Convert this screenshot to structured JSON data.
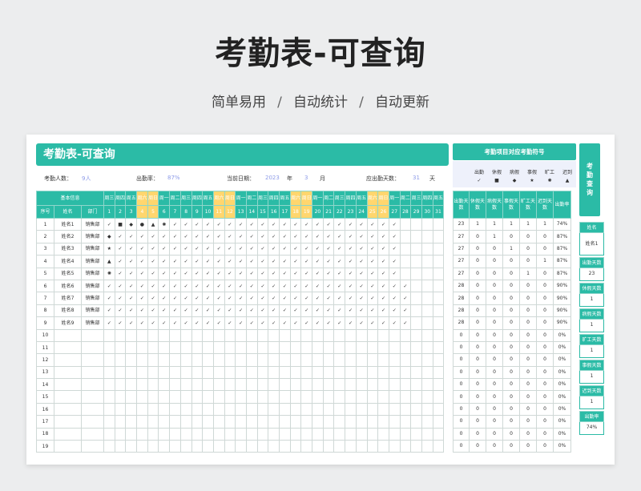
{
  "hero": {
    "title": "考勤表-可查询",
    "taglines": [
      "简单易用",
      "自动统计",
      "自动更新"
    ],
    "separator": "/"
  },
  "sheet": {
    "banner_title": "考勤表-可查询",
    "info": {
      "headcount_label": "考勤人数：",
      "headcount_value": "9人",
      "rate_label": "出勤率：",
      "rate_value": "87%",
      "date_label": "当前日期：",
      "year_value": "2023",
      "year_unit": "年",
      "month_value": "3",
      "month_unit": "月",
      "workdays_label": "应出勤天数：",
      "workdays_value": "31",
      "workdays_unit": "天"
    },
    "header": {
      "basic_info": "基本信息",
      "col_seq": "序号",
      "col_name": "姓名",
      "col_dept": "部门",
      "weekdays": [
        "周三",
        "周四",
        "周五",
        "周六",
        "周日",
        "周一",
        "周二",
        "周三",
        "周四",
        "周五",
        "周六",
        "周日",
        "周一",
        "周二",
        "周三",
        "周四",
        "周五",
        "周六",
        "周日",
        "周一",
        "周二",
        "周三",
        "周四",
        "周五",
        "周六",
        "周日",
        "周一",
        "周二",
        "周三",
        "周四",
        "周五"
      ],
      "days": [
        "1",
        "2",
        "3",
        "4",
        "5",
        "6",
        "7",
        "8",
        "9",
        "10",
        "11",
        "12",
        "13",
        "14",
        "15",
        "16",
        "17",
        "18",
        "19",
        "20",
        "21",
        "22",
        "23",
        "24",
        "25",
        "26",
        "27",
        "28",
        "29",
        "30",
        "31"
      ]
    },
    "rows": [
      {
        "seq": "1",
        "name": "姓名1",
        "dept": "销售部",
        "marks": [
          "✓",
          "■",
          "◆",
          "●",
          "▲",
          "✺",
          "✓",
          "✓",
          "✓",
          "✓",
          "✓",
          "✓",
          "✓",
          "✓",
          "✓",
          "✓",
          "✓",
          "✓",
          "✓",
          "✓",
          "✓",
          "✓",
          "✓",
          "✓",
          "✓",
          "✓",
          "✓",
          "",
          "",
          "",
          ""
        ]
      },
      {
        "seq": "2",
        "name": "姓名2",
        "dept": "销售部",
        "marks": [
          "◆",
          "✓",
          "✓",
          "✓",
          "✓",
          "✓",
          "✓",
          "✓",
          "✓",
          "✓",
          "✓",
          "✓",
          "✓",
          "✓",
          "✓",
          "✓",
          "✓",
          "✓",
          "✓",
          "✓",
          "✓",
          "✓",
          "✓",
          "✓",
          "✓",
          "✓",
          "✓",
          "",
          "",
          "",
          ""
        ]
      },
      {
        "seq": "3",
        "name": "姓名3",
        "dept": "销售部",
        "marks": [
          "★",
          "✓",
          "✓",
          "✓",
          "✓",
          "✓",
          "✓",
          "✓",
          "✓",
          "✓",
          "✓",
          "✓",
          "✓",
          "✓",
          "✓",
          "✓",
          "✓",
          "✓",
          "✓",
          "✓",
          "✓",
          "✓",
          "✓",
          "✓",
          "✓",
          "✓",
          "✓",
          "",
          "",
          "",
          ""
        ]
      },
      {
        "seq": "4",
        "name": "姓名4",
        "dept": "销售部",
        "marks": [
          "▲",
          "✓",
          "✓",
          "✓",
          "✓",
          "✓",
          "✓",
          "✓",
          "✓",
          "✓",
          "✓",
          "✓",
          "✓",
          "✓",
          "✓",
          "✓",
          "✓",
          "✓",
          "✓",
          "✓",
          "✓",
          "✓",
          "✓",
          "✓",
          "✓",
          "✓",
          "✓",
          "",
          "",
          "",
          ""
        ]
      },
      {
        "seq": "5",
        "name": "姓名5",
        "dept": "销售部",
        "marks": [
          "✺",
          "✓",
          "✓",
          "✓",
          "✓",
          "✓",
          "✓",
          "✓",
          "✓",
          "✓",
          "✓",
          "✓",
          "✓",
          "✓",
          "✓",
          "✓",
          "✓",
          "✓",
          "✓",
          "✓",
          "✓",
          "✓",
          "✓",
          "✓",
          "✓",
          "✓",
          "✓",
          "",
          "",
          "",
          ""
        ]
      },
      {
        "seq": "6",
        "name": "姓名6",
        "dept": "销售部",
        "marks": [
          "✓",
          "✓",
          "✓",
          "✓",
          "✓",
          "✓",
          "✓",
          "✓",
          "✓",
          "✓",
          "✓",
          "✓",
          "✓",
          "✓",
          "✓",
          "✓",
          "✓",
          "✓",
          "✓",
          "✓",
          "✓",
          "✓",
          "✓",
          "✓",
          "✓",
          "✓",
          "✓",
          "✓",
          "",
          "",
          ""
        ]
      },
      {
        "seq": "7",
        "name": "姓名7",
        "dept": "销售部",
        "marks": [
          "✓",
          "✓",
          "✓",
          "✓",
          "✓",
          "✓",
          "✓",
          "✓",
          "✓",
          "✓",
          "✓",
          "✓",
          "✓",
          "✓",
          "✓",
          "✓",
          "✓",
          "✓",
          "✓",
          "✓",
          "✓",
          "✓",
          "✓",
          "✓",
          "✓",
          "✓",
          "✓",
          "✓",
          "",
          "",
          ""
        ]
      },
      {
        "seq": "8",
        "name": "姓名8",
        "dept": "销售部",
        "marks": [
          "✓",
          "✓",
          "✓",
          "✓",
          "✓",
          "✓",
          "✓",
          "✓",
          "✓",
          "✓",
          "✓",
          "✓",
          "✓",
          "✓",
          "✓",
          "✓",
          "✓",
          "✓",
          "✓",
          "✓",
          "✓",
          "✓",
          "✓",
          "✓",
          "✓",
          "✓",
          "✓",
          "✓",
          "",
          "",
          ""
        ]
      },
      {
        "seq": "9",
        "name": "姓名9",
        "dept": "销售部",
        "marks": [
          "✓",
          "✓",
          "✓",
          "✓",
          "✓",
          "✓",
          "✓",
          "✓",
          "✓",
          "✓",
          "✓",
          "✓",
          "✓",
          "✓",
          "✓",
          "✓",
          "✓",
          "✓",
          "✓",
          "✓",
          "✓",
          "✓",
          "✓",
          "✓",
          "✓",
          "✓",
          "✓",
          "✓",
          "",
          "",
          ""
        ]
      },
      {
        "seq": "10",
        "name": "",
        "dept": "",
        "marks": []
      },
      {
        "seq": "11",
        "name": "",
        "dept": "",
        "marks": []
      },
      {
        "seq": "12",
        "name": "",
        "dept": "",
        "marks": []
      },
      {
        "seq": "13",
        "name": "",
        "dept": "",
        "marks": []
      },
      {
        "seq": "14",
        "name": "",
        "dept": "",
        "marks": []
      },
      {
        "seq": "15",
        "name": "",
        "dept": "",
        "marks": []
      },
      {
        "seq": "16",
        "name": "",
        "dept": "",
        "marks": []
      },
      {
        "seq": "17",
        "name": "",
        "dept": "",
        "marks": []
      },
      {
        "seq": "18",
        "name": "",
        "dept": "",
        "marks": []
      },
      {
        "seq": "19",
        "name": "",
        "dept": "",
        "marks": []
      }
    ]
  },
  "legend": {
    "title": "考勤项目对应考勤符号",
    "items": [
      "出勤",
      "休假",
      "病假",
      "事假",
      "旷工",
      "迟到"
    ],
    "symbols": [
      "✓",
      "■",
      "◆",
      "★",
      "✺",
      "▲"
    ]
  },
  "stats": {
    "headers": [
      "出勤天数",
      "休假天数",
      "病假天数",
      "事假天数",
      "旷工天数",
      "迟到天数",
      "出勤率"
    ],
    "rows": [
      [
        "23",
        "1",
        "1",
        "1",
        "1",
        "1",
        "74%"
      ],
      [
        "27",
        "0",
        "1",
        "0",
        "0",
        "0",
        "87%"
      ],
      [
        "27",
        "0",
        "0",
        "1",
        "0",
        "0",
        "87%"
      ],
      [
        "27",
        "0",
        "0",
        "0",
        "0",
        "1",
        "87%"
      ],
      [
        "27",
        "0",
        "0",
        "0",
        "1",
        "0",
        "87%"
      ],
      [
        "28",
        "0",
        "0",
        "0",
        "0",
        "0",
        "90%"
      ],
      [
        "28",
        "0",
        "0",
        "0",
        "0",
        "0",
        "90%"
      ],
      [
        "28",
        "0",
        "0",
        "0",
        "0",
        "0",
        "90%"
      ],
      [
        "28",
        "0",
        "0",
        "0",
        "0",
        "0",
        "90%"
      ],
      [
        "0",
        "0",
        "0",
        "0",
        "0",
        "0",
        "0%"
      ],
      [
        "0",
        "0",
        "0",
        "0",
        "0",
        "0",
        "0%"
      ],
      [
        "0",
        "0",
        "0",
        "0",
        "0",
        "0",
        "0%"
      ],
      [
        "0",
        "0",
        "0",
        "0",
        "0",
        "0",
        "0%"
      ],
      [
        "0",
        "0",
        "0",
        "0",
        "0",
        "0",
        "0%"
      ],
      [
        "0",
        "0",
        "0",
        "0",
        "0",
        "0",
        "0%"
      ],
      [
        "0",
        "0",
        "0",
        "0",
        "0",
        "0",
        "0%"
      ],
      [
        "0",
        "0",
        "0",
        "0",
        "0",
        "0",
        "0%"
      ],
      [
        "0",
        "0",
        "0",
        "0",
        "0",
        "0",
        "0%"
      ],
      [
        "0",
        "0",
        "0",
        "0",
        "0",
        "0",
        "0%"
      ]
    ]
  },
  "query": {
    "button": "考勤查询",
    "name_label": "姓名",
    "name_value": "姓名1",
    "fields": [
      {
        "label": "出勤天数",
        "value": "23"
      },
      {
        "label": "休假天数",
        "value": "1"
      },
      {
        "label": "病假天数",
        "value": "1"
      },
      {
        "label": "旷工天数",
        "value": "1"
      },
      {
        "label": "事假天数",
        "value": "1"
      },
      {
        "label": "迟到天数",
        "value": "1"
      },
      {
        "label": "出勤率",
        "value": "74%"
      }
    ]
  },
  "colors": {
    "accent": "#2bbba6",
    "weekend": "#ffd66e",
    "value": "#8d9be8"
  }
}
